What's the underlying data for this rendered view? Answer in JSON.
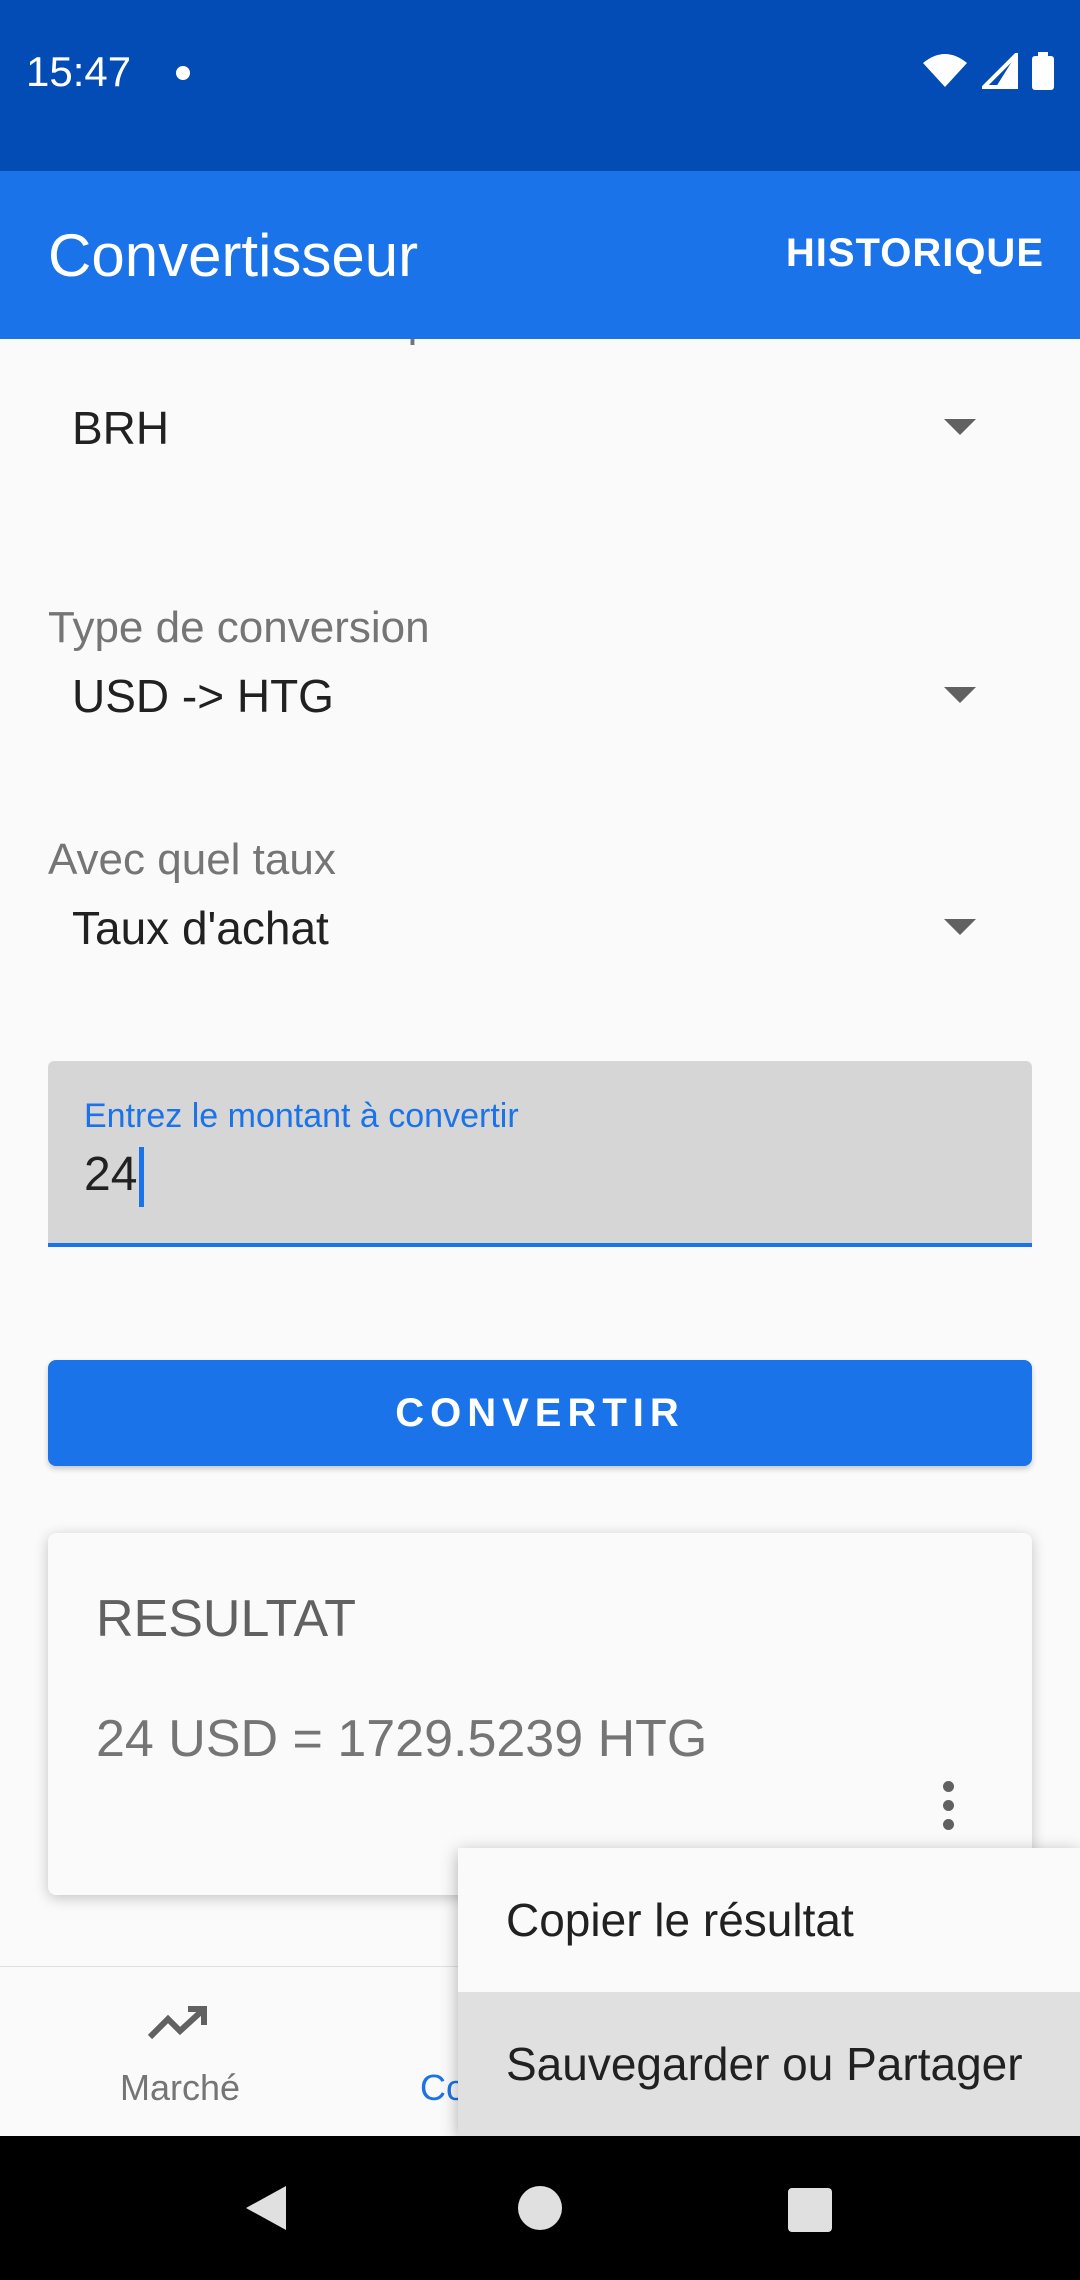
{
  "status_bar": {
    "time": "15:47"
  },
  "app_bar": {
    "title": "Convertisseur",
    "history_label": "HISTORIQUE"
  },
  "form": {
    "bank": {
      "label_partial": "Choisissez la banque",
      "value": "BRH"
    },
    "conversion_type": {
      "label": "Type de conversion",
      "value": "USD -> HTG"
    },
    "rate": {
      "label": "Avec quel taux",
      "value": "Taux d'achat"
    },
    "amount": {
      "label": "Entrez le montant à convertir",
      "value": "24"
    },
    "convert_label": "CONVERTIR"
  },
  "result": {
    "title": "RESULTAT",
    "text": "24 USD = 1729.5239 HTG"
  },
  "bottom_nav": {
    "items": [
      {
        "label": "Marché"
      },
      {
        "label": "Co"
      }
    ]
  },
  "popup_menu": {
    "items": [
      {
        "label": "Copier le résultat"
      },
      {
        "label": "Sauvegarder ou Partager"
      }
    ]
  },
  "colors": {
    "primary": "#1a73e8",
    "status_bar": "#034cb5"
  },
  "icons": [
    "wifi-icon",
    "signal-icon",
    "battery-icon",
    "trending-up-icon",
    "more-vert-icon",
    "nav-back-icon",
    "nav-home-icon",
    "nav-recents-icon"
  ]
}
